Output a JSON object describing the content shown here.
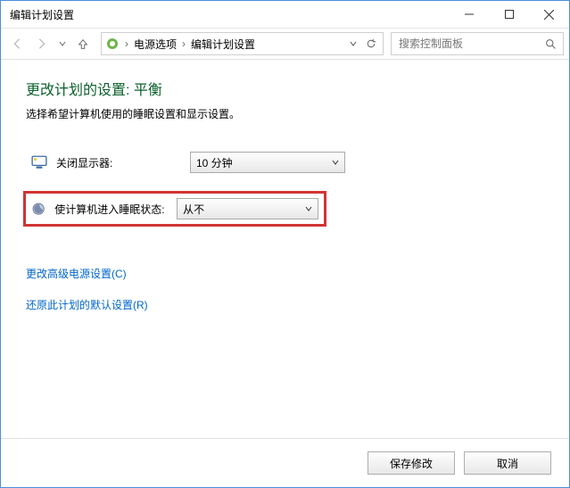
{
  "window": {
    "title": "编辑计划设置"
  },
  "breadcrumb": {
    "items": [
      "电源选项",
      "编辑计划设置"
    ]
  },
  "search": {
    "placeholder": "搜索控制面板"
  },
  "page": {
    "heading": "更改计划的设置: 平衡",
    "subtext": "选择希望计算机使用的睡眠设置和显示设置。"
  },
  "settings": {
    "display_off": {
      "label": "关闭显示器:",
      "value": "10 分钟"
    },
    "sleep": {
      "label": "使计算机进入睡眠状态:",
      "value": "从不"
    }
  },
  "links": {
    "advanced": "更改高级电源设置(C)",
    "restore": "还原此计划的默认设置(R)"
  },
  "buttons": {
    "save": "保存修改",
    "cancel": "取消"
  }
}
